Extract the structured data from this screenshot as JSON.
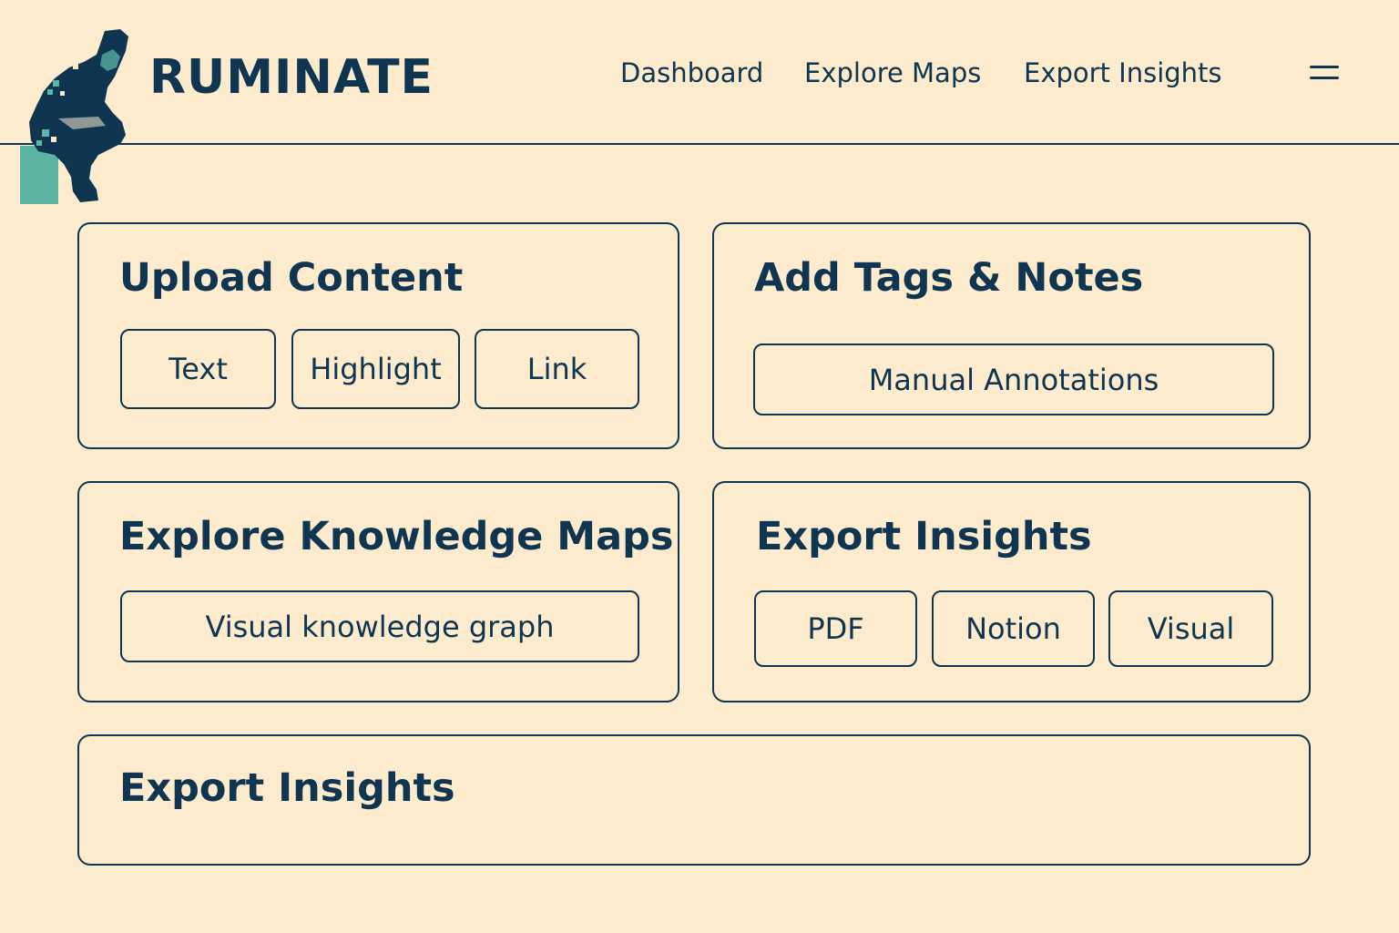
{
  "header": {
    "brand": "RUMINATE",
    "nav": [
      {
        "label": "Dashboard"
      },
      {
        "label": "Explore Maps"
      },
      {
        "label": "Export Insights"
      }
    ],
    "menu_icon": "hamburger-menu-icon",
    "logo_icon": "thinker-statue-icon"
  },
  "cards": {
    "upload": {
      "title": "Upload Content",
      "buttons": [
        "Text",
        "Highlight",
        "Link"
      ]
    },
    "tags": {
      "title": "Add Tags & Notes",
      "buttons": [
        "Manual Annotations"
      ]
    },
    "explore": {
      "title": "Explore Knowledge Maps",
      "buttons": [
        "Visual knowledge graph"
      ]
    },
    "export": {
      "title": "Export Insights",
      "buttons": [
        "PDF",
        "Notion",
        "Visual"
      ]
    },
    "export_bottom": {
      "title": "Export Insights"
    }
  },
  "colors": {
    "background": "#FCEBCD",
    "primary": "#0F3550",
    "accent": "#5BB5A2"
  }
}
